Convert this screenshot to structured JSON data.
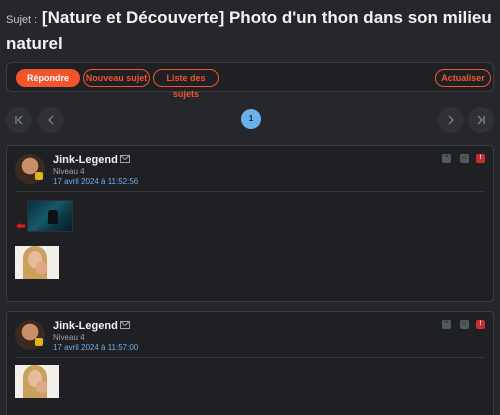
{
  "topic": {
    "prefix": "Sujet :",
    "title": "[Nature et Découverte] Photo d'un thon dans son milieu naturel"
  },
  "toolbar": {
    "reply_label": "Répondre",
    "new_topic_label": "Nouveau sujet",
    "topic_list_label": "Liste des sujets",
    "refresh_label": "Actualiser"
  },
  "pagination": {
    "current_page": "1"
  },
  "colors": {
    "accent": "#f2552c",
    "link": "#6ab1ec",
    "background": "#25272c",
    "panel": "#1f2024",
    "report": "#c92e2e"
  },
  "posts": [
    {
      "author": "Jink-Legend",
      "rank": "Niveau 4",
      "date": "17 avril 2024 à 11:52:56"
    },
    {
      "author": "Jink-Legend",
      "rank": "Niveau 4",
      "date": "17 avril 2024 à 11:57:00"
    }
  ]
}
